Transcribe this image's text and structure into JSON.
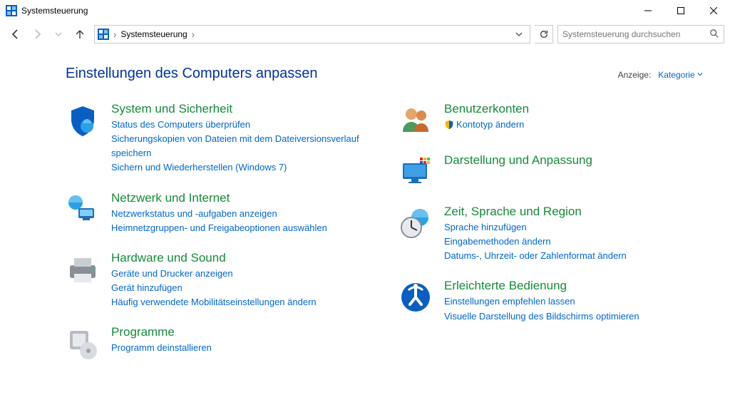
{
  "window": {
    "title": "Systemsteuerung"
  },
  "nav": {
    "breadcrumb": "Systemsteuerung"
  },
  "search": {
    "placeholder": "Systemsteuerung durchsuchen"
  },
  "header": {
    "heading": "Einstellungen des Computers anpassen",
    "view_label": "Anzeige:",
    "view_value": "Kategorie"
  },
  "left": [
    {
      "title": "System und Sicherheit",
      "links": [
        "Status des Computers überprüfen",
        "Sicherungskopien von Dateien mit dem Dateiversionsverlauf speichern",
        "Sichern und Wiederherstellen (Windows 7)"
      ]
    },
    {
      "title": "Netzwerk und Internet",
      "links": [
        "Netzwerkstatus und -aufgaben anzeigen",
        "Heimnetzgruppen- und Freigabeoptionen auswählen"
      ]
    },
    {
      "title": "Hardware und Sound",
      "links": [
        "Geräte und Drucker anzeigen",
        "Gerät hinzufügen",
        "Häufig verwendete Mobilitätseinstellungen ändern"
      ]
    },
    {
      "title": "Programme",
      "links": [
        "Programm deinstallieren"
      ]
    }
  ],
  "right": [
    {
      "title": "Benutzerkonten",
      "links": [
        "Kontotyp ändern"
      ]
    },
    {
      "title": "Darstellung und Anpassung",
      "links": []
    },
    {
      "title": "Zeit, Sprache und Region",
      "links": [
        "Sprache hinzufügen",
        "Eingabemethoden ändern",
        "Datums-, Uhrzeit- oder Zahlenformat ändern"
      ]
    },
    {
      "title": "Erleichterte Bedienung",
      "links": [
        "Einstellungen empfehlen lassen",
        "Visuelle Darstellung des Bildschirms optimieren"
      ]
    }
  ]
}
